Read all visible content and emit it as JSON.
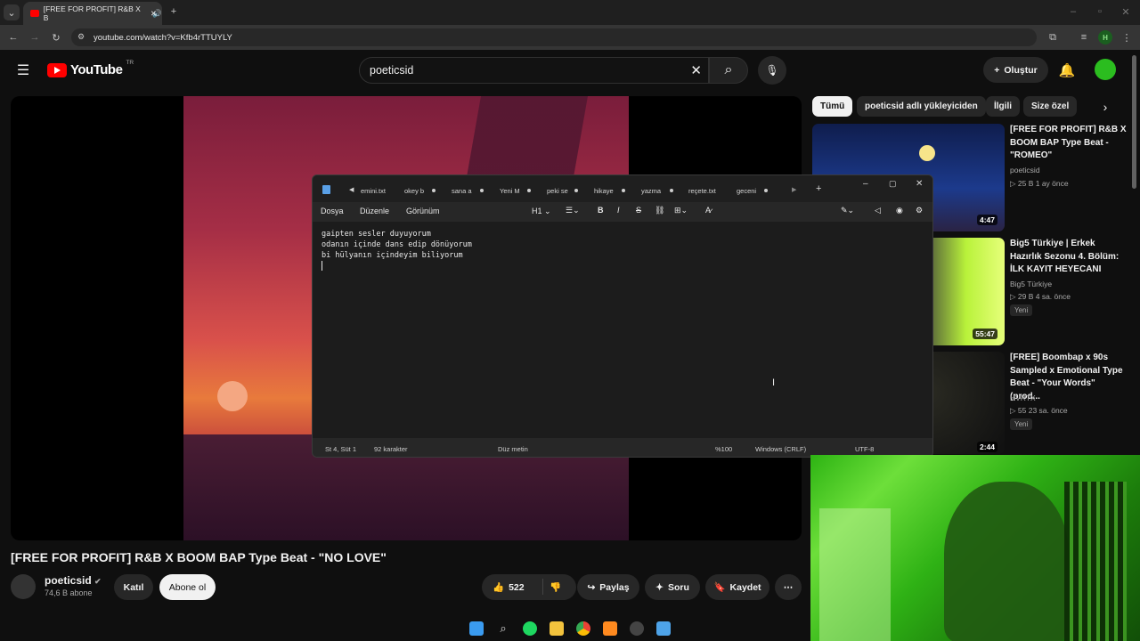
{
  "browser": {
    "tab_title": "[FREE FOR PROFIT] R&B X B",
    "url": "youtube.com/watch?v=Kfb4rTTUYLY",
    "profile_initial": "H"
  },
  "youtube": {
    "logo_text": "YouTube",
    "region": "TR",
    "search_query": "poeticsid",
    "create_label": "Oluştur"
  },
  "video": {
    "title": "[FREE FOR PROFIT] R&B X BOOM BAP Type Beat - \"NO LOVE\"",
    "channel": "poeticsid",
    "subscribers": "74,6 B abone",
    "join_label": "Katıl",
    "subscribe_label": "Abone ol",
    "likes": "522",
    "share_label": "Paylaş",
    "ask_label": "Soru",
    "save_label": "Kaydet"
  },
  "chips": [
    "Tümü",
    "poeticsid adlı yükleyiciden",
    "İlgili",
    "Size özel"
  ],
  "recommendations": [
    {
      "title": "[FREE FOR PROFIT] R&B X BOOM BAP Type Beat - \"ROMEO\"",
      "channel": "poeticsid",
      "meta": "▷ 25 B   1 ay önce",
      "duration": "4:47",
      "badge": ""
    },
    {
      "title": "Big5 Türkiye | Erkek Hazırlık Sezonu 4. Bölüm: İLK KAYIT HEYECANI",
      "channel": "Big5 Türkiye",
      "meta": "▷ 29 B   4 sa. önce",
      "duration": "55:47",
      "badge": "Yeni"
    },
    {
      "title": "[FREE] Boombap x 90s Sampled x Emotional Type Beat - \"Your Words\" (prod...",
      "channel": "HVRTX",
      "meta": "▷ 55   23 sa. önce",
      "duration": "2:44",
      "badge": "Yeni"
    }
  ],
  "notepad": {
    "tabs": [
      "emini.txt",
      "okey b",
      "sana a",
      "Yeni M",
      "peki se",
      "hikaye",
      "yazma",
      "reçete.txt",
      "geceni"
    ],
    "menu": [
      "Dosya",
      "Düzenle",
      "Görünüm"
    ],
    "heading": "H1",
    "lines": [
      "gaipten sesler duyuyorum",
      "odanın içinde dans edip dönüyorum",
      "bi hülyanın içindeyim biliyorum"
    ],
    "status": {
      "position": "St 4, Süt 1",
      "chars": "92 karakter",
      "format": "Düz metin",
      "zoom": "%100",
      "eol": "Windows (CRLF)",
      "encoding": "UTF-8"
    }
  },
  "colors": {
    "accent_red": "#ff0000",
    "background": "#0f0f0f",
    "webcam_green": "#2db313"
  }
}
